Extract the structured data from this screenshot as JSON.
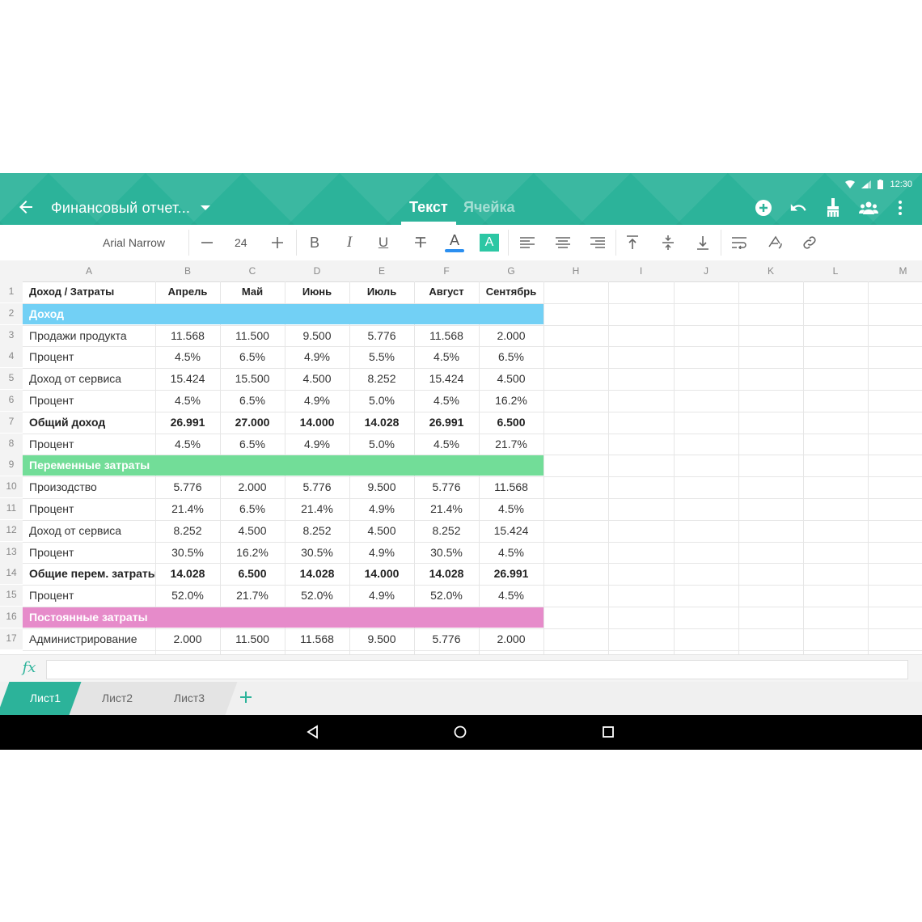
{
  "status_bar": {
    "time": "12:30"
  },
  "header": {
    "title": "Финансовый отчет...",
    "tabs": [
      {
        "label": "Текст",
        "active": true
      },
      {
        "label": "Ячейка",
        "active": false
      }
    ],
    "accent_color": "#2cb39a"
  },
  "toolbar": {
    "font_name": "Arial Narrow",
    "font_size": "24",
    "bold": "B",
    "italic": "I",
    "underline": "U",
    "fill_letter": "A",
    "text_color_letter": "A"
  },
  "grid": {
    "columns": [
      "A",
      "B",
      "C",
      "D",
      "E",
      "F",
      "G",
      "H",
      "I",
      "J",
      "K",
      "L",
      "M"
    ],
    "rows": [
      {
        "num": "1",
        "type": "header",
        "cells": [
          "Доход / Затраты",
          "Апрель",
          "Май",
          "Июнь",
          "Июль",
          "Август",
          "Сентябрь"
        ]
      },
      {
        "num": "2",
        "type": "section",
        "color": "#72d0f5",
        "cells": [
          "Доход"
        ]
      },
      {
        "num": "3",
        "type": "normal",
        "cells": [
          "Продажи продукта",
          "11.568",
          "11.500",
          "9.500",
          "5.776",
          "11.568",
          "2.000"
        ]
      },
      {
        "num": "4",
        "type": "normal",
        "cells": [
          "Процент",
          "4.5%",
          "6.5%",
          "4.9%",
          "5.5%",
          "4.5%",
          "6.5%"
        ]
      },
      {
        "num": "5",
        "type": "normal",
        "cells": [
          "Доход от сервиса",
          "15.424",
          "15.500",
          "4.500",
          "8.252",
          "15.424",
          "4.500"
        ]
      },
      {
        "num": "6",
        "type": "normal",
        "cells": [
          "Процент",
          "4.5%",
          "6.5%",
          "4.9%",
          "5.0%",
          "4.5%",
          "16.2%"
        ]
      },
      {
        "num": "7",
        "type": "bold",
        "cells": [
          "Общий доход",
          "26.991",
          "27.000",
          "14.000",
          "14.028",
          "26.991",
          "6.500"
        ]
      },
      {
        "num": "8",
        "type": "normal",
        "cells": [
          "Процент",
          "4.5%",
          "6.5%",
          "4.9%",
          "5.0%",
          "4.5%",
          "21.7%"
        ]
      },
      {
        "num": "9",
        "type": "section",
        "color": "#72dd98",
        "cells": [
          "Переменные затраты"
        ]
      },
      {
        "num": "10",
        "type": "normal",
        "cells": [
          "Произодство",
          "5.776",
          "2.000",
          "5.776",
          "9.500",
          "5.776",
          "11.568"
        ]
      },
      {
        "num": "11",
        "type": "normal",
        "cells": [
          "Процент",
          "21.4%",
          "6.5%",
          "21.4%",
          "4.9%",
          "21.4%",
          "4.5%"
        ]
      },
      {
        "num": "12",
        "type": "normal",
        "cells": [
          "Доход от сервиса",
          "8.252",
          "4.500",
          "8.252",
          "4.500",
          "8.252",
          "15.424"
        ]
      },
      {
        "num": "13",
        "type": "normal",
        "cells": [
          "Процент",
          "30.5%",
          "16.2%",
          "30.5%",
          "4.9%",
          "30.5%",
          "4.5%"
        ]
      },
      {
        "num": "14",
        "type": "bold",
        "cells": [
          "Общие перем. затраты",
          "14.028",
          "6.500",
          "14.028",
          "14.000",
          "14.028",
          "26.991"
        ]
      },
      {
        "num": "15",
        "type": "normal",
        "cells": [
          "Процент",
          "52.0%",
          "21.7%",
          "52.0%",
          "4.9%",
          "52.0%",
          "4.5%"
        ]
      },
      {
        "num": "16",
        "type": "section",
        "color": "#e68bca",
        "cells": [
          "Постоянные затраты"
        ]
      },
      {
        "num": "17",
        "type": "normal",
        "cells": [
          "Администрирование",
          "2.000",
          "11.500",
          "11.568",
          "9.500",
          "5.776",
          "2.000"
        ]
      }
    ]
  },
  "formula_bar": {
    "label": "fx",
    "value": ""
  },
  "sheets": [
    {
      "label": "Лист1",
      "active": true
    },
    {
      "label": "Лист2",
      "active": false
    },
    {
      "label": "Лист3",
      "active": false
    }
  ],
  "icons": {
    "back": "arrow-left-icon",
    "dropdown": "caret-down-icon",
    "add": "plus-circle-icon",
    "undo": "undo-icon",
    "clear": "broom-icon",
    "share": "people-icon",
    "more": "more-vert-icon",
    "nav_back": "triangle-back-icon",
    "nav_home": "circle-home-icon",
    "nav_recent": "square-recent-icon"
  }
}
